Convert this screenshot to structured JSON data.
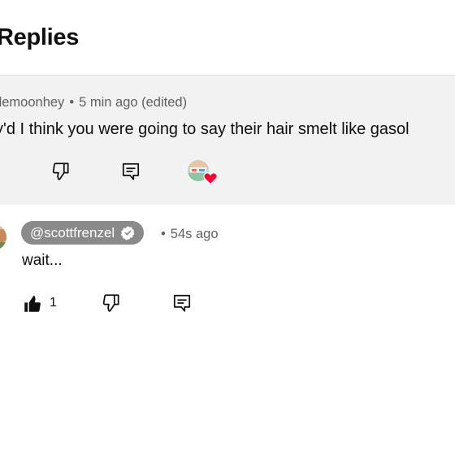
{
  "header": {
    "title": "Replies"
  },
  "parent_comment": {
    "author": "tlemoonhey",
    "separator": "•",
    "time": "5 min ago (edited)",
    "text": "y'd I think you were going to say their hair smelt like gasol",
    "icons": [
      "dislike-icon",
      "reply-icon",
      "creator-heart-icon"
    ]
  },
  "reply": {
    "author": "@scottfrenzel",
    "separator": "•",
    "time": "54s ago",
    "text": "wait...",
    "like_count": "1",
    "icons": [
      "like-icon",
      "dislike-icon",
      "reply-icon",
      "verified-icon"
    ]
  },
  "colors": {
    "parent_background": "#f2f2f2",
    "author_chip": "#8a8a8a",
    "heart": "#ff0033",
    "meta_text": "#606060"
  }
}
